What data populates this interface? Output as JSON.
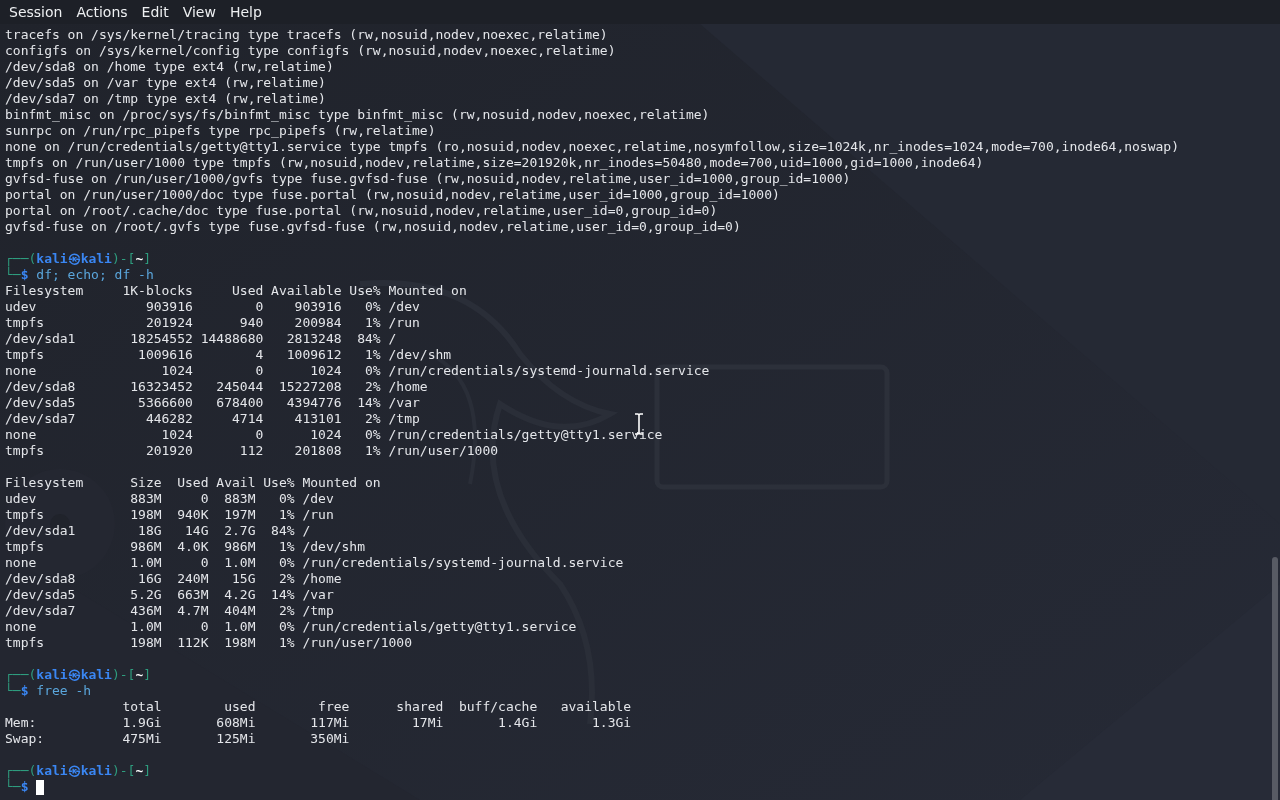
{
  "menu": [
    "Session",
    "Actions",
    "Edit",
    "View",
    "Help"
  ],
  "lines": [
    {
      "kind": "output",
      "text": "tracefs on /sys/kernel/tracing type tracefs (rw,nosuid,nodev,noexec,relatime)"
    },
    {
      "kind": "output",
      "text": "configfs on /sys/kernel/config type configfs (rw,nosuid,nodev,noexec,relatime)"
    },
    {
      "kind": "output",
      "text": "/dev/sda8 on /home type ext4 (rw,relatime)"
    },
    {
      "kind": "output",
      "text": "/dev/sda5 on /var type ext4 (rw,relatime)"
    },
    {
      "kind": "output",
      "text": "/dev/sda7 on /tmp type ext4 (rw,relatime)"
    },
    {
      "kind": "output",
      "text": "binfmt_misc on /proc/sys/fs/binfmt_misc type binfmt_misc (rw,nosuid,nodev,noexec,relatime)"
    },
    {
      "kind": "output",
      "text": "sunrpc on /run/rpc_pipefs type rpc_pipefs (rw,relatime)"
    },
    {
      "kind": "output",
      "text": "none on /run/credentials/getty@tty1.service type tmpfs (ro,nosuid,nodev,noexec,relatime,nosymfollow,size=1024k,nr_inodes=1024,mode=700,inode64,noswap)"
    },
    {
      "kind": "output",
      "text": "tmpfs on /run/user/1000 type tmpfs (rw,nosuid,nodev,relatime,size=201920k,nr_inodes=50480,mode=700,uid=1000,gid=1000,inode64)"
    },
    {
      "kind": "output",
      "text": "gvfsd-fuse on /run/user/1000/gvfs type fuse.gvfsd-fuse (rw,nosuid,nodev,relatime,user_id=1000,group_id=1000)"
    },
    {
      "kind": "output",
      "text": "portal on /run/user/1000/doc type fuse.portal (rw,nosuid,nodev,relatime,user_id=1000,group_id=1000)"
    },
    {
      "kind": "output",
      "text": "portal on /root/.cache/doc type fuse.portal (rw,nosuid,nodev,relatime,user_id=0,group_id=0)"
    },
    {
      "kind": "output",
      "text": "gvfsd-fuse on /root/.gvfs type fuse.gvfsd-fuse (rw,nosuid,nodev,relatime,user_id=0,group_id=0)"
    },
    {
      "kind": "blank"
    },
    {
      "kind": "prompt",
      "frame_top": "┌──(",
      "user": "kali",
      "at": "㉿",
      "host": "kali",
      "bracket_open": ")-[",
      "dir": "~",
      "bracket_close": "]",
      "frame_bottom": "└─",
      "sign": "$",
      "command": "df; echo; df -h",
      "cursor": false
    },
    {
      "kind": "output",
      "text": "Filesystem     1K-blocks     Used Available Use% Mounted on"
    },
    {
      "kind": "output",
      "text": "udev              903916        0    903916   0% /dev"
    },
    {
      "kind": "output",
      "text": "tmpfs             201924      940    200984   1% /run"
    },
    {
      "kind": "output",
      "text": "/dev/sda1       18254552 14488680   2813248  84% /"
    },
    {
      "kind": "output",
      "text": "tmpfs            1009616        4   1009612   1% /dev/shm"
    },
    {
      "kind": "output",
      "text": "none                1024        0      1024   0% /run/credentials/systemd-journald.service"
    },
    {
      "kind": "output",
      "text": "/dev/sda8       16323452   245044  15227208   2% /home"
    },
    {
      "kind": "output",
      "text": "/dev/sda5        5366600   678400   4394776  14% /var"
    },
    {
      "kind": "output",
      "text": "/dev/sda7         446282     4714    413101   2% /tmp"
    },
    {
      "kind": "output",
      "text": "none                1024        0      1024   0% /run/credentials/getty@tty1.service"
    },
    {
      "kind": "output",
      "text": "tmpfs             201920      112    201808   1% /run/user/1000"
    },
    {
      "kind": "blank"
    },
    {
      "kind": "output",
      "text": "Filesystem      Size  Used Avail Use% Mounted on"
    },
    {
      "kind": "output",
      "text": "udev            883M     0  883M   0% /dev"
    },
    {
      "kind": "output",
      "text": "tmpfs           198M  940K  197M   1% /run"
    },
    {
      "kind": "output",
      "text": "/dev/sda1        18G   14G  2.7G  84% /"
    },
    {
      "kind": "output",
      "text": "tmpfs           986M  4.0K  986M   1% /dev/shm"
    },
    {
      "kind": "output",
      "text": "none            1.0M     0  1.0M   0% /run/credentials/systemd-journald.service"
    },
    {
      "kind": "output",
      "text": "/dev/sda8        16G  240M   15G   2% /home"
    },
    {
      "kind": "output",
      "text": "/dev/sda5       5.2G  663M  4.2G  14% /var"
    },
    {
      "kind": "output",
      "text": "/dev/sda7       436M  4.7M  404M   2% /tmp"
    },
    {
      "kind": "output",
      "text": "none            1.0M     0  1.0M   0% /run/credentials/getty@tty1.service"
    },
    {
      "kind": "output",
      "text": "tmpfs           198M  112K  198M   1% /run/user/1000"
    },
    {
      "kind": "blank"
    },
    {
      "kind": "prompt",
      "frame_top": "┌──(",
      "user": "kali",
      "at": "㉿",
      "host": "kali",
      "bracket_open": ")-[",
      "dir": "~",
      "bracket_close": "]",
      "frame_bottom": "└─",
      "sign": "$",
      "command": "free -h",
      "cursor": false
    },
    {
      "kind": "output",
      "text": "               total        used        free      shared  buff/cache   available"
    },
    {
      "kind": "output",
      "text": "Mem:           1.9Gi       608Mi       117Mi        17Mi       1.4Gi       1.3Gi"
    },
    {
      "kind": "output",
      "text": "Swap:          475Mi       125Mi       350Mi"
    },
    {
      "kind": "blank"
    },
    {
      "kind": "prompt",
      "frame_top": "┌──(",
      "user": "kali",
      "at": "㉿",
      "host": "kali",
      "bracket_open": ")-[",
      "dir": "~",
      "bracket_close": "]",
      "frame_bottom": "└─",
      "sign": "$",
      "cursor": true
    }
  ]
}
